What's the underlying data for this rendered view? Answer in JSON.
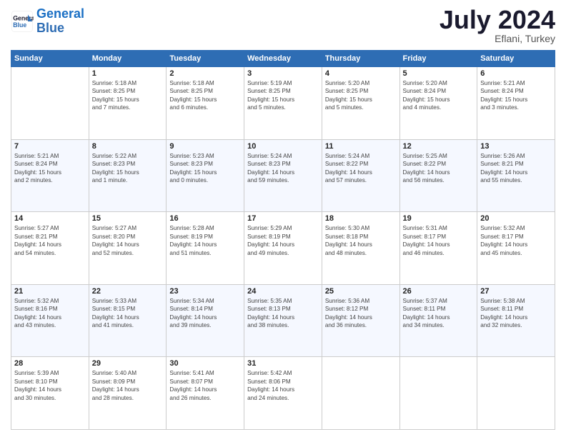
{
  "header": {
    "logo_line1": "General",
    "logo_line2": "Blue",
    "month": "July 2024",
    "location": "Eflani, Turkey"
  },
  "days_of_week": [
    "Sunday",
    "Monday",
    "Tuesday",
    "Wednesday",
    "Thursday",
    "Friday",
    "Saturday"
  ],
  "weeks": [
    [
      {
        "day": "",
        "info": ""
      },
      {
        "day": "1",
        "info": "Sunrise: 5:18 AM\nSunset: 8:25 PM\nDaylight: 15 hours\nand 7 minutes."
      },
      {
        "day": "2",
        "info": "Sunrise: 5:18 AM\nSunset: 8:25 PM\nDaylight: 15 hours\nand 6 minutes."
      },
      {
        "day": "3",
        "info": "Sunrise: 5:19 AM\nSunset: 8:25 PM\nDaylight: 15 hours\nand 5 minutes."
      },
      {
        "day": "4",
        "info": "Sunrise: 5:20 AM\nSunset: 8:25 PM\nDaylight: 15 hours\nand 5 minutes."
      },
      {
        "day": "5",
        "info": "Sunrise: 5:20 AM\nSunset: 8:24 PM\nDaylight: 15 hours\nand 4 minutes."
      },
      {
        "day": "6",
        "info": "Sunrise: 5:21 AM\nSunset: 8:24 PM\nDaylight: 15 hours\nand 3 minutes."
      }
    ],
    [
      {
        "day": "7",
        "info": "Sunrise: 5:21 AM\nSunset: 8:24 PM\nDaylight: 15 hours\nand 2 minutes."
      },
      {
        "day": "8",
        "info": "Sunrise: 5:22 AM\nSunset: 8:23 PM\nDaylight: 15 hours\nand 1 minute."
      },
      {
        "day": "9",
        "info": "Sunrise: 5:23 AM\nSunset: 8:23 PM\nDaylight: 15 hours\nand 0 minutes."
      },
      {
        "day": "10",
        "info": "Sunrise: 5:24 AM\nSunset: 8:23 PM\nDaylight: 14 hours\nand 59 minutes."
      },
      {
        "day": "11",
        "info": "Sunrise: 5:24 AM\nSunset: 8:22 PM\nDaylight: 14 hours\nand 57 minutes."
      },
      {
        "day": "12",
        "info": "Sunrise: 5:25 AM\nSunset: 8:22 PM\nDaylight: 14 hours\nand 56 minutes."
      },
      {
        "day": "13",
        "info": "Sunrise: 5:26 AM\nSunset: 8:21 PM\nDaylight: 14 hours\nand 55 minutes."
      }
    ],
    [
      {
        "day": "14",
        "info": "Sunrise: 5:27 AM\nSunset: 8:21 PM\nDaylight: 14 hours\nand 54 minutes."
      },
      {
        "day": "15",
        "info": "Sunrise: 5:27 AM\nSunset: 8:20 PM\nDaylight: 14 hours\nand 52 minutes."
      },
      {
        "day": "16",
        "info": "Sunrise: 5:28 AM\nSunset: 8:19 PM\nDaylight: 14 hours\nand 51 minutes."
      },
      {
        "day": "17",
        "info": "Sunrise: 5:29 AM\nSunset: 8:19 PM\nDaylight: 14 hours\nand 49 minutes."
      },
      {
        "day": "18",
        "info": "Sunrise: 5:30 AM\nSunset: 8:18 PM\nDaylight: 14 hours\nand 48 minutes."
      },
      {
        "day": "19",
        "info": "Sunrise: 5:31 AM\nSunset: 8:17 PM\nDaylight: 14 hours\nand 46 minutes."
      },
      {
        "day": "20",
        "info": "Sunrise: 5:32 AM\nSunset: 8:17 PM\nDaylight: 14 hours\nand 45 minutes."
      }
    ],
    [
      {
        "day": "21",
        "info": "Sunrise: 5:32 AM\nSunset: 8:16 PM\nDaylight: 14 hours\nand 43 minutes."
      },
      {
        "day": "22",
        "info": "Sunrise: 5:33 AM\nSunset: 8:15 PM\nDaylight: 14 hours\nand 41 minutes."
      },
      {
        "day": "23",
        "info": "Sunrise: 5:34 AM\nSunset: 8:14 PM\nDaylight: 14 hours\nand 39 minutes."
      },
      {
        "day": "24",
        "info": "Sunrise: 5:35 AM\nSunset: 8:13 PM\nDaylight: 14 hours\nand 38 minutes."
      },
      {
        "day": "25",
        "info": "Sunrise: 5:36 AM\nSunset: 8:12 PM\nDaylight: 14 hours\nand 36 minutes."
      },
      {
        "day": "26",
        "info": "Sunrise: 5:37 AM\nSunset: 8:11 PM\nDaylight: 14 hours\nand 34 minutes."
      },
      {
        "day": "27",
        "info": "Sunrise: 5:38 AM\nSunset: 8:11 PM\nDaylight: 14 hours\nand 32 minutes."
      }
    ],
    [
      {
        "day": "28",
        "info": "Sunrise: 5:39 AM\nSunset: 8:10 PM\nDaylight: 14 hours\nand 30 minutes."
      },
      {
        "day": "29",
        "info": "Sunrise: 5:40 AM\nSunset: 8:09 PM\nDaylight: 14 hours\nand 28 minutes."
      },
      {
        "day": "30",
        "info": "Sunrise: 5:41 AM\nSunset: 8:07 PM\nDaylight: 14 hours\nand 26 minutes."
      },
      {
        "day": "31",
        "info": "Sunrise: 5:42 AM\nSunset: 8:06 PM\nDaylight: 14 hours\nand 24 minutes."
      },
      {
        "day": "",
        "info": ""
      },
      {
        "day": "",
        "info": ""
      },
      {
        "day": "",
        "info": ""
      }
    ]
  ]
}
